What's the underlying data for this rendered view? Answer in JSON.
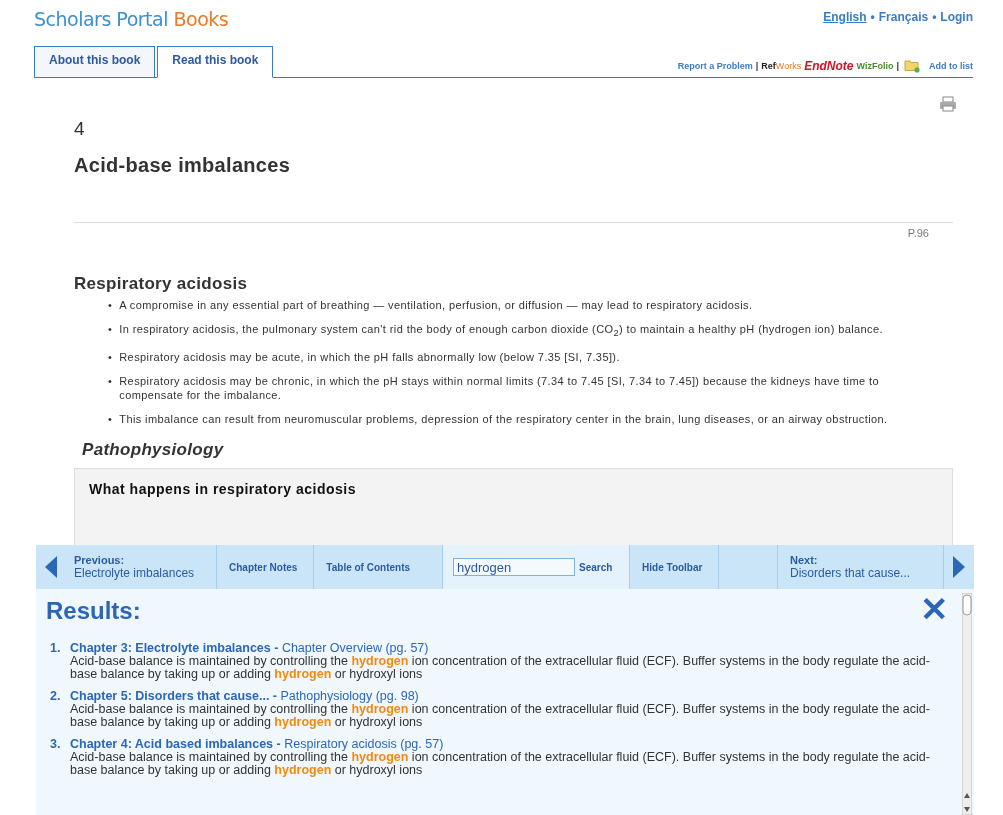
{
  "header": {
    "logo_primary": "Scholars Portal",
    "logo_secondary": "Books",
    "languages": [
      {
        "label": "English",
        "selected": true
      },
      {
        "label": "Français",
        "selected": false
      },
      {
        "label": "Login",
        "selected": false
      }
    ],
    "separator": "•"
  },
  "tabs": [
    {
      "label": "About this book",
      "selected": false
    },
    {
      "label": "Read this book",
      "selected": true
    }
  ],
  "tools": {
    "report": "Report a Problem",
    "divider": "|",
    "refworks_a": "Ref",
    "refworks_b": "Works",
    "endnote": "EndNote",
    "wizfolio": "WizFolio",
    "add_to_list": "Add to list"
  },
  "chapter": {
    "number": "4",
    "title": "Acid-base imbalances",
    "page": "P.96",
    "section": "Respiratory acidosis",
    "bullet": "•",
    "bullets": [
      "A compromise in any essential part of breathing — ventilation, perfusion, or diffusion — may lead to respiratory acidosis.",
      "In respiratory acidosis, the pulmonary system can't rid the body of enough carbon dioxide (CO$_{2}$) to maintain a healthy pH (hydrogen ion) balance.",
      "Respiratory acidosis may be acute, in which the pH falls abnormally low (below 7.35 [SI, 7.35]).",
      "Respiratory acidosis may be chronic, in which the pH stays within normal limits (7.34 to 7.45 [SI, 7.34 to 7.45]) because the kidneys have time to compensate for the imbalance.",
      "This imbalance can result from neuromuscular problems, depression of the respiratory center in the brain, lung diseases, or an airway obstruction."
    ],
    "subsection": "Pathophysiology",
    "box_title": "What happens in respiratory acidosis"
  },
  "toolbar": {
    "previous_label": "Previous:",
    "previous_title": "Electrolyte imbalances",
    "chapter_notes": "Chapter Notes",
    "table_of_contents": "Table of Contents",
    "search_value": "hydrogen",
    "search_button": "Search",
    "hide_toolbar": "Hide Toolbar",
    "next_label": "Next:",
    "next_title": "Disorders that cause..."
  },
  "results": {
    "title": "Results:",
    "close": "✕",
    "items": [
      {
        "number": "1.",
        "chapter": "Chapter 3: Electrolyte imbalances -",
        "section": "Chapter Overview (pg. 57)",
        "snippet": "Acid-base balance is maintained by controlling the **hydrogen** ion concentration of the extracellular fluid (ECF). Buffer systems in the body regulate the acid-base balance by taking up or adding **hydrogen** or hydroxyl ions"
      },
      {
        "number": "2.",
        "chapter": "Chapter 5: Disorders that cause... -",
        "section": "Pathophysiology (pg. 98)",
        "snippet": "Acid-base balance is maintained by controlling the **hydrogen** ion concentration of the extracellular fluid (ECF). Buffer systems in the body regulate the acid-base balance by taking up or adding **hydrogen** or hydroxyl ions"
      },
      {
        "number": "3.",
        "chapter": "Chapter 4: Acid based imbalances -",
        "section": "Respiratory acidosis (pg. 57)",
        "snippet": "Acid-base balance is maintained by controlling the **hydrogen** ion concentration of the extracellular fluid (ECF). Buffer systems in the body regulate the acid-base balance by taking up or adding **hydrogen** or hydroxyl ions"
      }
    ]
  }
}
